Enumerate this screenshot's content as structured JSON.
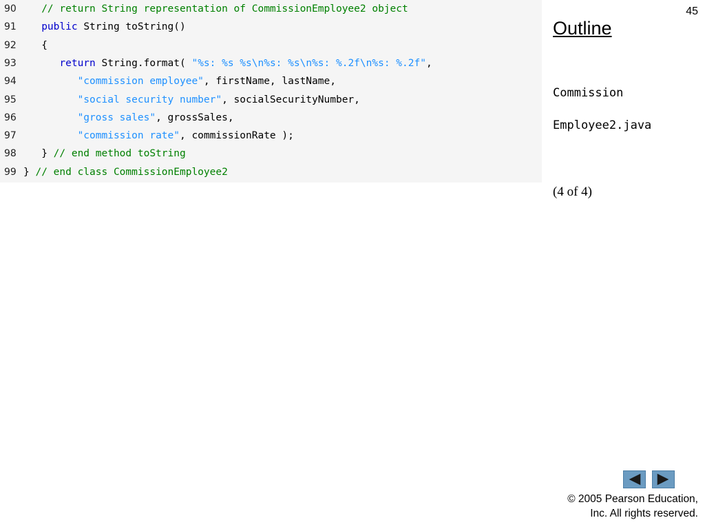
{
  "page_number": "45",
  "outline_label": "Outline",
  "filename_line1": "Commission",
  "filename_line2": "Employee2.java",
  "part_label": "(4 of 4)",
  "copyright_line1": "© 2005 Pearson Education,",
  "copyright_line2": "Inc.  All rights reserved.",
  "nav": {
    "prev_icon": "triangle-left-icon",
    "next_icon": "triangle-right-icon"
  },
  "code_lines": [
    {
      "num": "90",
      "tokens": [
        {
          "t": "   ",
          "c": "plain"
        },
        {
          "t": "// return String representation of CommissionEmployee2 object",
          "c": "comment"
        }
      ]
    },
    {
      "num": "91",
      "tokens": [
        {
          "t": "   ",
          "c": "plain"
        },
        {
          "t": "public",
          "c": "keyword"
        },
        {
          "t": " String toString()",
          "c": "plain"
        }
      ]
    },
    {
      "num": "92",
      "tokens": [
        {
          "t": "   {",
          "c": "plain"
        }
      ]
    },
    {
      "num": "93",
      "tokens": [
        {
          "t": "      ",
          "c": "plain"
        },
        {
          "t": "return",
          "c": "keyword"
        },
        {
          "t": " String.format( ",
          "c": "plain"
        },
        {
          "t": "\"%s: %s %s\\n%s: %s\\n%s: %.2f\\n%s: %.2f\"",
          "c": "string"
        },
        {
          "t": ",",
          "c": "plain"
        }
      ]
    },
    {
      "num": "94",
      "tokens": [
        {
          "t": "         ",
          "c": "plain"
        },
        {
          "t": "\"commission employee\"",
          "c": "string"
        },
        {
          "t": ", firstName, lastName,",
          "c": "plain"
        }
      ]
    },
    {
      "num": "95",
      "tokens": [
        {
          "t": "         ",
          "c": "plain"
        },
        {
          "t": "\"social security number\"",
          "c": "string"
        },
        {
          "t": ", socialSecurityNumber,",
          "c": "plain"
        }
      ]
    },
    {
      "num": "96",
      "tokens": [
        {
          "t": "         ",
          "c": "plain"
        },
        {
          "t": "\"gross sales\"",
          "c": "string"
        },
        {
          "t": ", grossSales,",
          "c": "plain"
        }
      ]
    },
    {
      "num": "97",
      "tokens": [
        {
          "t": "         ",
          "c": "plain"
        },
        {
          "t": "\"commission rate\"",
          "c": "string"
        },
        {
          "t": ", commissionRate );",
          "c": "plain"
        }
      ]
    },
    {
      "num": "98",
      "tokens": [
        {
          "t": "   } ",
          "c": "plain"
        },
        {
          "t": "// end method toString",
          "c": "comment"
        }
      ]
    },
    {
      "num": "99",
      "tokens": [
        {
          "t": "} ",
          "c": "plain"
        },
        {
          "t": "// end class CommissionEmployee2",
          "c": "comment"
        }
      ]
    }
  ]
}
